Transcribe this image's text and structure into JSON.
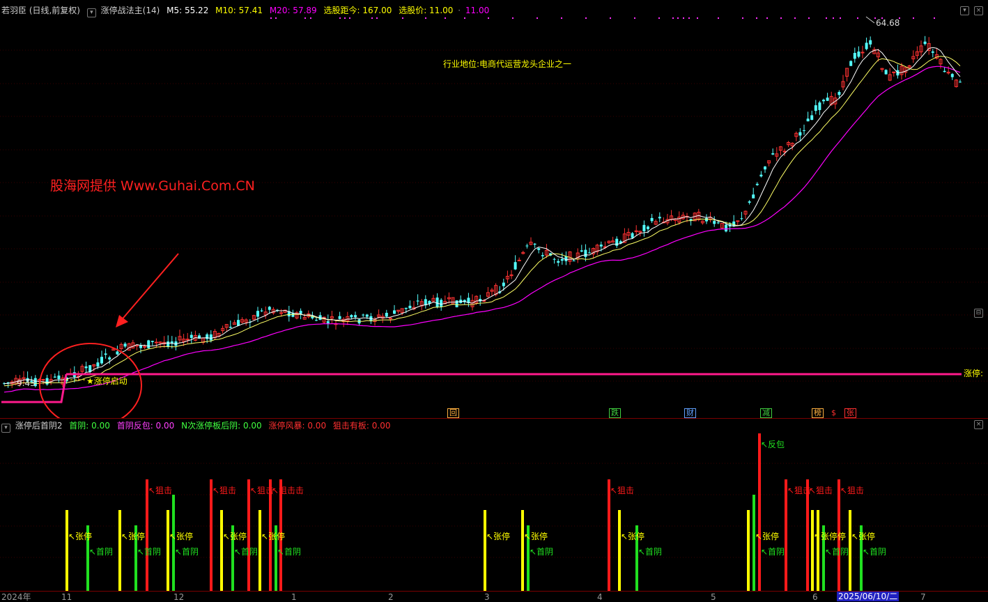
{
  "main_header": {
    "stock": "若羽臣 (日线,前复权)",
    "indicator": "涨停战法主(14)",
    "m5": "M5: 55.22",
    "m10": "M10: 57.41",
    "m20": "M20: 57.89",
    "dist": "选股距今: 167.00",
    "price": "选股价: 11.00",
    "price2": "11.00"
  },
  "sub_header": {
    "indicator": "涨停后首阴2",
    "shouyin": "首阴: 0.00",
    "fanbao": "首阴反包: 0.00",
    "nci": "N次涨停板后阴: 0.00",
    "fengbao": "涨停风暴: 0.00",
    "juji": "狙击有板: 0.00"
  },
  "annotations": {
    "industry": "行业地位:电商代运营龙头企业之一",
    "watermark": "股海网提供 Www.Guhai.Com.CN",
    "start_label": "★涨停启动",
    "high_label": "64.68",
    "low_label": "9.43",
    "right_label": "涨停:"
  },
  "event_tags": [
    {
      "text": "回",
      "color": "#ffb040"
    },
    {
      "text": "跌",
      "color": "#40d040"
    },
    {
      "text": "财",
      "color": "#60a0ff"
    },
    {
      "text": "减",
      "color": "#40d040"
    },
    {
      "text": "榜",
      "color": "#ffb040"
    },
    {
      "text": "$",
      "color": "#ff3030"
    },
    {
      "text": "张",
      "color": "#ff3030"
    }
  ],
  "x_axis": [
    "2024年",
    "11",
    "12",
    "1",
    "2",
    "3",
    "4",
    "5",
    "6",
    "2025/06/10/二",
    "7"
  ],
  "signal_labels": {
    "zhangting": "张停",
    "shouyin": "首阴",
    "juji": "狙击",
    "fanbao": "反包",
    "juji_double": "狙击击",
    "zhangting_double": "张停停"
  },
  "colors": {
    "up": "#ff3232",
    "down": "#54ffff",
    "ma5": "#ffffff",
    "ma10": "#ffff00",
    "ma20": "#ff00ff",
    "limit_line": "#ff1a8c",
    "grid": "#3a0000"
  }
}
